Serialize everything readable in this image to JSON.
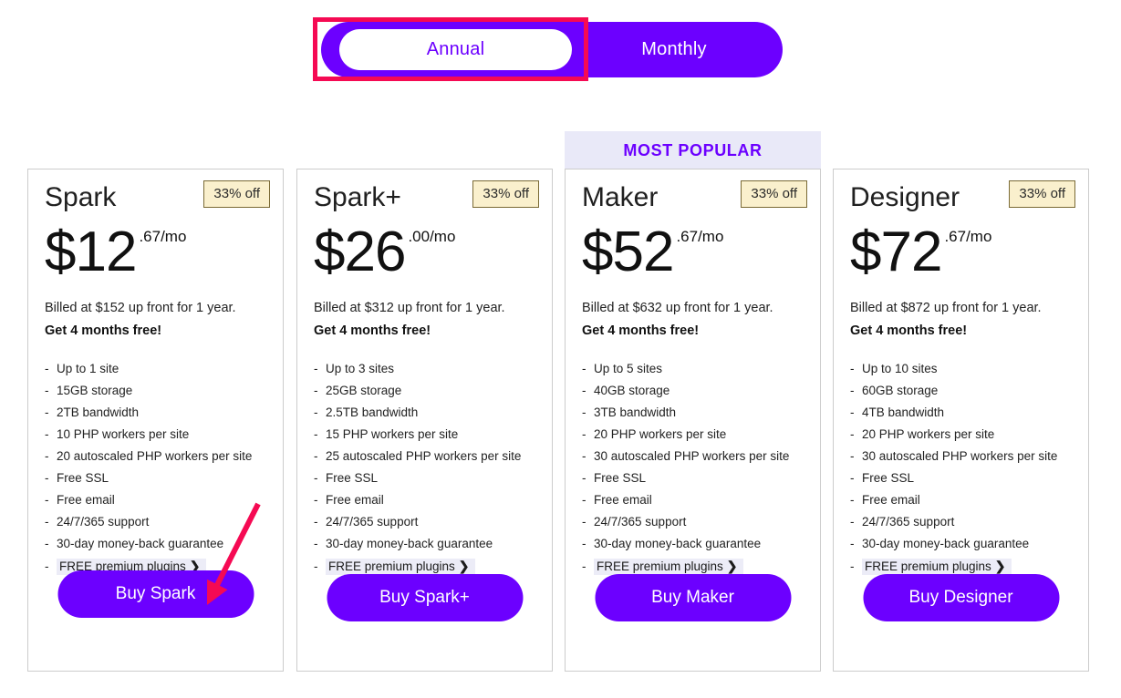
{
  "billing_toggle": {
    "annual_label": "Annual",
    "monthly_label": "Monthly",
    "selected": "Annual",
    "accent_color": "#6C00FF"
  },
  "annotations": {
    "highlight_color": "#F50A53",
    "highlight_target": "Annual",
    "arrow_target": "Buy Spark"
  },
  "popular_banner": {
    "label": "MOST POPULAR",
    "background": "#E9E9F8",
    "text_color": "#6C00FF"
  },
  "plans": [
    {
      "name": "Spark",
      "discount": "33% off",
      "price_main": "$12",
      "price_cents": ".67/mo",
      "billed": "Billed at $152 up front for 1 year.",
      "months_free": "Get 4 months free!",
      "features": [
        "Up to 1 site",
        "15GB storage",
        "2TB bandwidth",
        "10 PHP workers per site",
        "20 autoscaled PHP workers per site",
        "Free SSL",
        "Free email",
        "24/7/365 support",
        "30-day money-back guarantee"
      ],
      "plugins_label": "FREE premium plugins",
      "buy_label": "Buy Spark",
      "most_popular": false
    },
    {
      "name": "Spark+",
      "discount": "33% off",
      "price_main": "$26",
      "price_cents": ".00/mo",
      "billed": "Billed at $312 up front for 1 year.",
      "months_free": "Get 4 months free!",
      "features": [
        "Up to 3 sites",
        "25GB storage",
        "2.5TB bandwidth",
        "15 PHP workers per site",
        "25 autoscaled PHP workers per site",
        "Free SSL",
        "Free email",
        "24/7/365 support",
        "30-day money-back guarantee"
      ],
      "plugins_label": "FREE premium plugins",
      "buy_label": "Buy Spark+",
      "most_popular": false
    },
    {
      "name": "Maker",
      "discount": "33% off",
      "price_main": "$52",
      "price_cents": ".67/mo",
      "billed": "Billed at $632 up front for 1 year.",
      "months_free": "Get 4 months free!",
      "features": [
        "Up to 5 sites",
        "40GB storage",
        "3TB bandwidth",
        "20 PHP workers per site",
        "30 autoscaled PHP workers per site",
        "Free SSL",
        "Free email",
        "24/7/365 support",
        "30-day money-back guarantee"
      ],
      "plugins_label": "FREE premium plugins",
      "buy_label": "Buy Maker",
      "most_popular": true
    },
    {
      "name": "Designer",
      "discount": "33% off",
      "price_main": "$72",
      "price_cents": ".67/mo",
      "billed": "Billed at $872 up front for 1 year.",
      "months_free": "Get 4 months free!",
      "features": [
        "Up to 10 sites",
        "60GB storage",
        "4TB bandwidth",
        "20 PHP workers per site",
        "30 autoscaled PHP workers per site",
        "Free SSL",
        "Free email",
        "24/7/365 support",
        "30-day money-back guarantee"
      ],
      "plugins_label": "FREE premium plugins",
      "buy_label": "Buy Designer",
      "most_popular": false
    }
  ]
}
